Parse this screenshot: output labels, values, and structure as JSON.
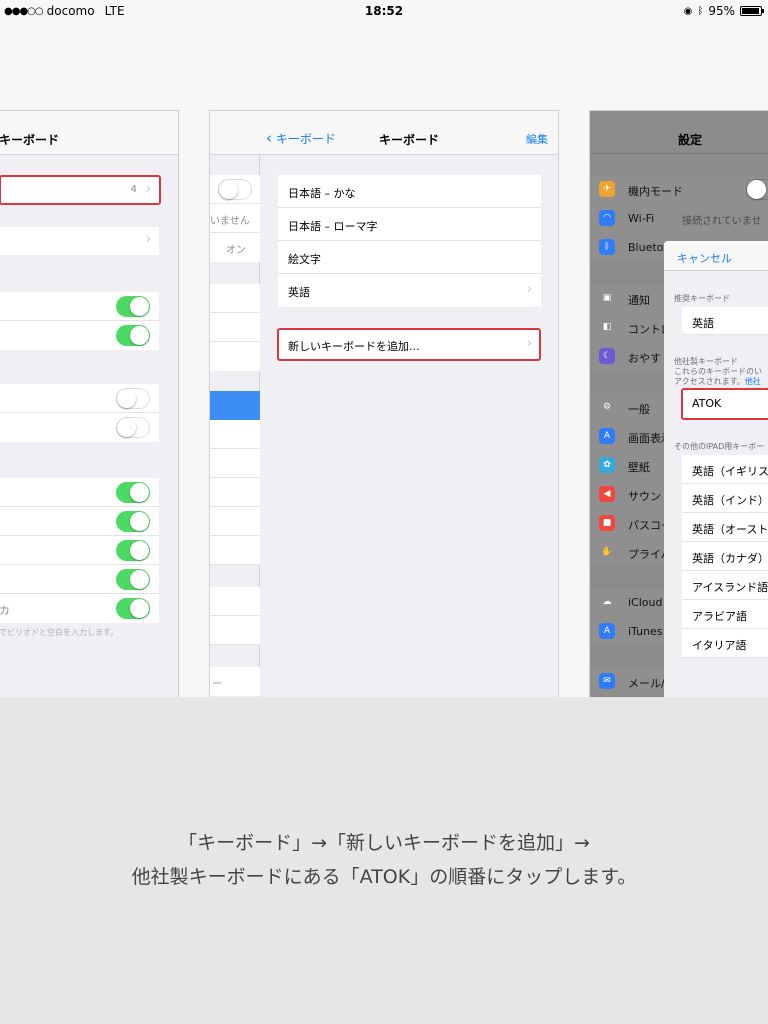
{
  "status_bar": {
    "signal": "●●●○○",
    "carrier": "docomo",
    "network": "LTE",
    "time": "18:52",
    "battery_text": "95%",
    "battery_level": 0.95
  },
  "panel_left": {
    "title": "キーボード",
    "keyboards_count": "4",
    "row_text": "カ",
    "footer_note": "でピリオドと空白を入力します。"
  },
  "panel_middle": {
    "back_label": "キーボード",
    "title": "キーボード",
    "edit_label": "編集",
    "strip_texts": [
      "いません",
      "オン",
      "ー"
    ],
    "keyboards": [
      "日本語 – かな",
      "日本語 – ローマ字",
      "絵文字",
      "英語"
    ],
    "add_keyboard": "新しいキーボードを追加..."
  },
  "panel_right": {
    "title": "設定",
    "settings_rows": [
      {
        "label": "機内モード",
        "icon": "airplane-icon",
        "color": "#f0a330"
      },
      {
        "label": "Wi-Fi",
        "icon": "wifi-icon",
        "color": "#2f7cf6"
      },
      {
        "label": "Bluetoo",
        "icon": "bluetooth-icon",
        "color": "#2f7cf6"
      },
      {
        "label": "通知",
        "icon": "notification-icon",
        "color": "#8e8e93"
      },
      {
        "label": "コントロ",
        "icon": "control-center-icon",
        "color": "#8e8e93"
      },
      {
        "label": "おやす",
        "icon": "moon-icon",
        "color": "#6c5bd1"
      },
      {
        "label": "一般",
        "icon": "gear-icon",
        "color": "#8e8e93"
      },
      {
        "label": "画面表示",
        "icon": "display-icon",
        "color": "#2f7cf6"
      },
      {
        "label": "壁紙",
        "icon": "wallpaper-icon",
        "color": "#36aadc"
      },
      {
        "label": "サウン",
        "icon": "sound-icon",
        "color": "#f2453d"
      },
      {
        "label": "パスコー",
        "icon": "passcode-icon",
        "color": "#f2453d"
      },
      {
        "label": "プライバ",
        "icon": "privacy-icon",
        "color": "#8e8e93"
      },
      {
        "label": "iCloud",
        "icon": "icloud-icon",
        "color": "#ffffff"
      },
      {
        "label": "iTunes",
        "icon": "appstore-icon",
        "color": "#2f7cf6"
      },
      {
        "label": "メール/連絡先/カレンダー",
        "icon": "mail-icon",
        "color": "#2f7cf6"
      }
    ],
    "wifi_value": "接続されていませ",
    "popup": {
      "cancel": "キャンセル",
      "suggested_header": "推奨キーボード",
      "suggested": "英語",
      "third_party_header": "他社製キーボード",
      "third_party_note1": "これらのキーボードのい",
      "third_party_note2": "アクセスされます。",
      "third_party_link": "他社",
      "third_party": "ATOK",
      "other_header": "その他のIPAD用キーボー",
      "others": [
        "英語（イギリス",
        "英語（インド）",
        "英語（オースト",
        "英語（カナダ）",
        "アイスランド語",
        "アラビア語",
        "イタリア語"
      ]
    }
  },
  "caption": {
    "line1": "「キーボード」→「新しいキーボードを追加」→",
    "line2": "他社製キーボードにある「ATOK」の順番にタップします。"
  }
}
